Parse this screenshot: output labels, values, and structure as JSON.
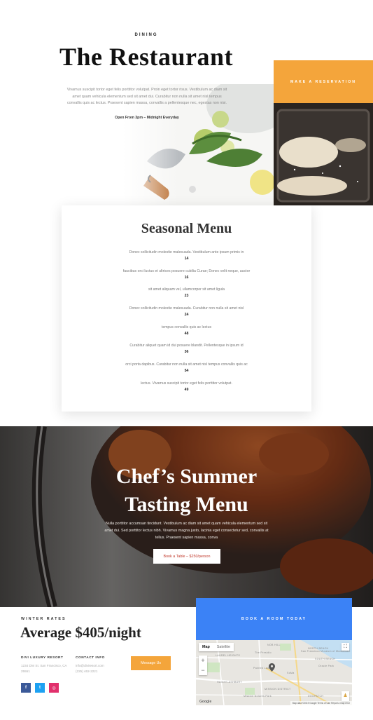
{
  "hero": {
    "eyebrow": "DINING",
    "title": "The Restaurant",
    "description": "Vivamus suscipit tortor eget felis porttitor volutpat. Proin eget tortor risus. Vestibulum ac diam sit amet quam vehicula elementum sed sit amet dui. Curabitur non nulla sit amet nisl tempus convallis quis ac lectus. Praesent sapien massa, convallis a pellentesque nec, egestas non nisi.",
    "hours": "Open From 3pm – Midnight Everyday",
    "reservation_label": "MAKE A RESERVATION",
    "accent_color": "#f4a53b"
  },
  "menu": {
    "title": "Seasonal Menu",
    "items": [
      {
        "desc": "Donec sollicitudin molestie malesuada. Vestibulum ante ipsum primis in",
        "price": "14"
      },
      {
        "desc": "faucibus orci luctus et ultrices posuere cubilia Curae; Donec velit neque, auctor",
        "price": "16"
      },
      {
        "desc": "sit amet aliquam vel, ullamcorper sit amet ligula",
        "price": "23"
      },
      {
        "desc": "Donec sollicitudin molestie malesuada. Curabitur non nulla sit amet nisl",
        "price": "24"
      },
      {
        "desc": "tempus convallis quis ac lectus",
        "price": "48"
      },
      {
        "desc": "Curabitur aliquet quam id dui posuere blandit. Pellentesque in ipsum id",
        "price": "36"
      },
      {
        "desc": "orci porta dapibus. Curabitur non nulla sit amet nisl tempus convallis quis ac",
        "price": "54"
      },
      {
        "desc": "lectus. Vivamus suscipit tortor eget felis porttitor volutpat.",
        "price": "49"
      }
    ]
  },
  "chef": {
    "title_line1": "Chef’s Summer",
    "title_line2": "Tasting Menu",
    "description": "Nulla porttitor accumsan tincidunt. Vestibulum ac diam sit amet quam vehicula elementum sed sit amet dui. Sed porttitor lectus nibh. Vivamus magna justo, lacinia eget consectetur sed, convallis at tellus. Praesent sapien massa, conva",
    "button_label": "Book a Table – $250/person",
    "button_text_color": "#c0392b"
  },
  "footer": {
    "winter_label": "WINTER RATES",
    "price_heading": "Average $405/night",
    "resort_label": "DIVI LUXURY RESORT",
    "resort_address": "1234 Divi St. San Francisco, CA 25551",
    "contact_label": "CONTACT INFO",
    "contact_email": "info@diviresort.com",
    "contact_phone": "(225) 462-2221",
    "message_label": "Message Us",
    "book_room_label": "BOOK A ROOM TODAY",
    "book_room_color": "#3b82f6",
    "social": [
      {
        "name": "facebook-icon",
        "glyph": "f",
        "color": "#3b5998"
      },
      {
        "name": "twitter-icon",
        "glyph": "t",
        "color": "#1da1f2"
      },
      {
        "name": "instagram-icon",
        "glyph": "◎",
        "color": "#e1306c"
      }
    ]
  },
  "map": {
    "type_map": "Map",
    "type_satellite": "Satellite",
    "zoom_in": "+",
    "zoom_out": "−",
    "fullscreen_icon": "⛶",
    "attribution": "Map data ©2019 Google   Terms of Use   Report a map error",
    "google": "Google",
    "labels": [
      "NOB HILL",
      "NORTH BEACH",
      "LAUREL HEIGHTS",
      "The Presidio",
      "Painted Ladies",
      "SoMa",
      "HAIGHT-ASHBURY",
      "SOUTH BEACH",
      "Oracle Park",
      "MISSION DISTRICT",
      "Mission Dolores Park",
      "DOGPATCH",
      "San Francisco Museum of Modern Art"
    ]
  }
}
